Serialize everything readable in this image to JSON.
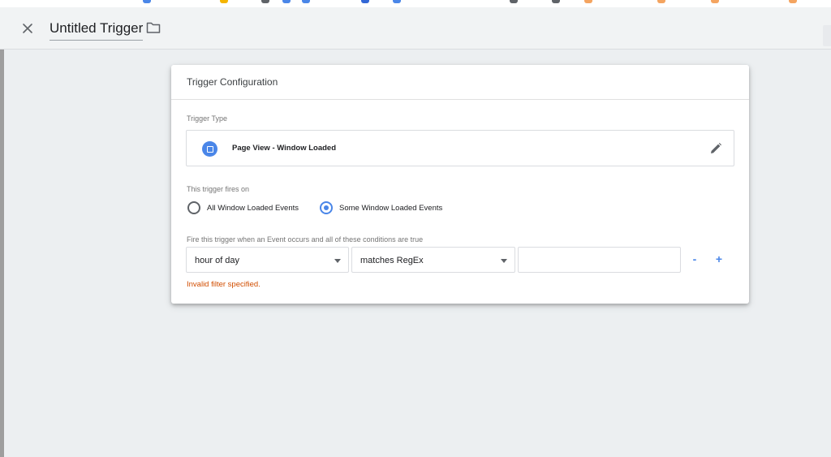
{
  "header": {
    "title": "Untitled Trigger",
    "close_icon": "close-icon",
    "folder_icon": "folder-icon"
  },
  "card": {
    "title": "Trigger Configuration",
    "trigger_type": {
      "label": "Trigger Type",
      "name": "Page View - Window Loaded",
      "icon": "page-view-icon",
      "icon_color": "#4a86e8",
      "edit_icon": "pencil-icon"
    },
    "fires_on": {
      "label": "This trigger fires on",
      "options": [
        {
          "label": "All Window Loaded Events",
          "checked": false
        },
        {
          "label": "Some Window Loaded Events",
          "checked": true
        }
      ]
    },
    "conditions": {
      "label": "Fire this trigger when an Event occurs and all of these conditions are true",
      "variable": "hour of day",
      "operator": "matches RegEx",
      "value": "",
      "remove_label": "-",
      "add_label": "+",
      "error": "Invalid filter specified."
    }
  },
  "colors": {
    "accent": "#4a86e8",
    "error": "#d14d00",
    "background": "#eceff1"
  }
}
